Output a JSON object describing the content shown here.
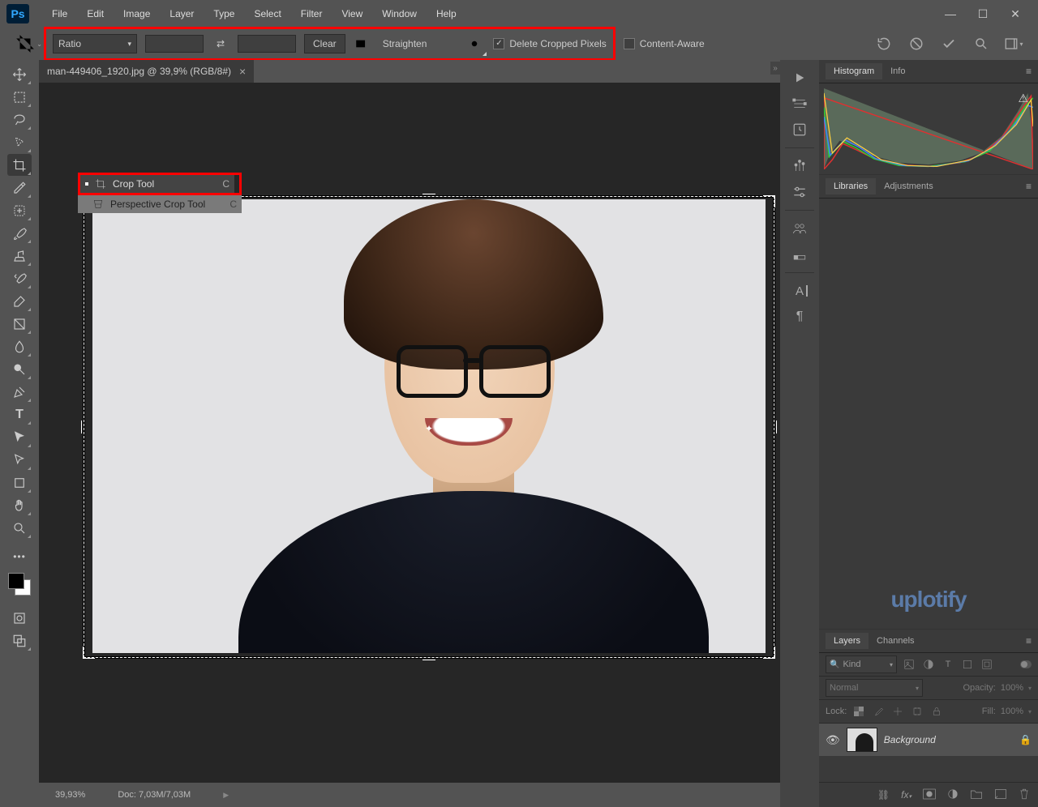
{
  "app": {
    "logo": "Ps"
  },
  "menu": [
    "File",
    "Edit",
    "Image",
    "Layer",
    "Type",
    "Select",
    "Filter",
    "View",
    "Window",
    "Help"
  ],
  "options": {
    "ratio_label": "Ratio",
    "clear": "Clear",
    "straighten": "Straighten",
    "delete_cropped": "Delete Cropped Pixels",
    "content_aware": "Content-Aware"
  },
  "tab": {
    "title": "man-449406_1920.jpg @ 39,9% (RGB/8#)",
    "close": "×"
  },
  "flyout": {
    "crop": {
      "label": "Crop Tool",
      "shortcut": "C"
    },
    "perspective": {
      "label": "Perspective Crop Tool",
      "shortcut": "C"
    }
  },
  "status": {
    "zoom": "39,93%",
    "doc": "Doc: 7,03M/7,03M"
  },
  "panels": {
    "histogram": "Histogram",
    "info": "Info",
    "libraries": "Libraries",
    "adjustments": "Adjustments",
    "watermark": "uplotify",
    "layers": "Layers",
    "channels": "Channels",
    "kind": "Kind",
    "normal": "Normal",
    "opacity_label": "Opacity:",
    "opacity_val": "100%",
    "lock_label": "Lock:",
    "fill_label": "Fill:",
    "fill_val": "100%",
    "bg_layer": "Background"
  }
}
